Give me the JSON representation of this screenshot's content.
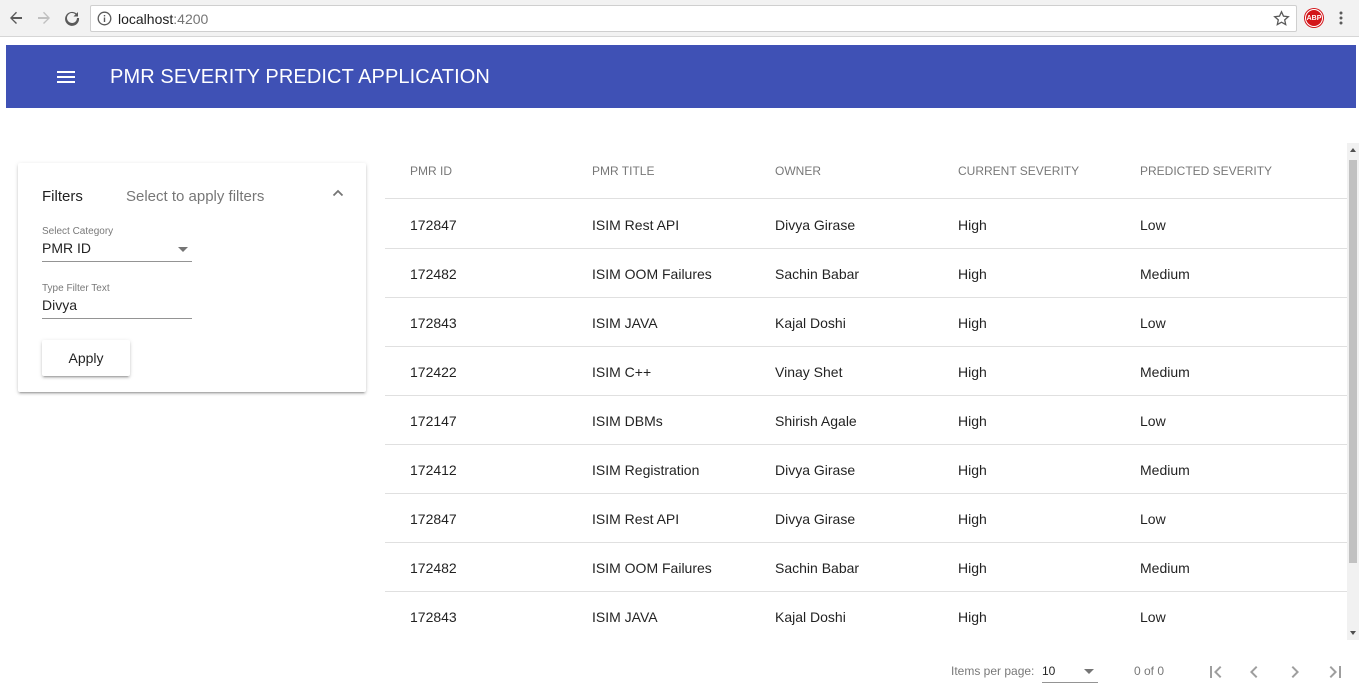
{
  "browser": {
    "url_host": "localhost",
    "url_port": ":4200"
  },
  "app": {
    "title": "PMR SEVERITY PREDICT APPLICATION",
    "primary_color": "#3f51b5"
  },
  "filters": {
    "title": "Filters",
    "description": "Select to apply filters",
    "category_label": "Select Category",
    "category_value": "PMR ID",
    "text_label": "Type Filter Text",
    "text_value": "Divya",
    "apply_label": "Apply"
  },
  "table": {
    "headers": [
      "PMR ID",
      "PMR TITLE",
      "OWNER",
      "CURRENT SEVERITY",
      "PREDICTED SEVERITY"
    ],
    "rows": [
      [
        "172847",
        "ISIM Rest API",
        "Divya Girase",
        "High",
        "Low"
      ],
      [
        "172482",
        "ISIM OOM Failures",
        "Sachin Babar",
        "High",
        "Medium"
      ],
      [
        "172843",
        "ISIM JAVA",
        "Kajal Doshi",
        "High",
        "Low"
      ],
      [
        "172422",
        "ISIM C++",
        "Vinay Shet",
        "High",
        "Medium"
      ],
      [
        "172147",
        "ISIM DBMs",
        "Shirish Agale",
        "High",
        "Low"
      ],
      [
        "172412",
        "ISIM Registration",
        "Divya Girase",
        "High",
        "Medium"
      ],
      [
        "172847",
        "ISIM Rest API",
        "Divya Girase",
        "High",
        "Low"
      ],
      [
        "172482",
        "ISIM OOM Failures",
        "Sachin Babar",
        "High",
        "Medium"
      ],
      [
        "172843",
        "ISIM JAVA",
        "Kajal Doshi",
        "High",
        "Low"
      ]
    ]
  },
  "paginator": {
    "items_per_page_label": "Items per page:",
    "page_size": "10",
    "range_label": "0 of 0"
  }
}
